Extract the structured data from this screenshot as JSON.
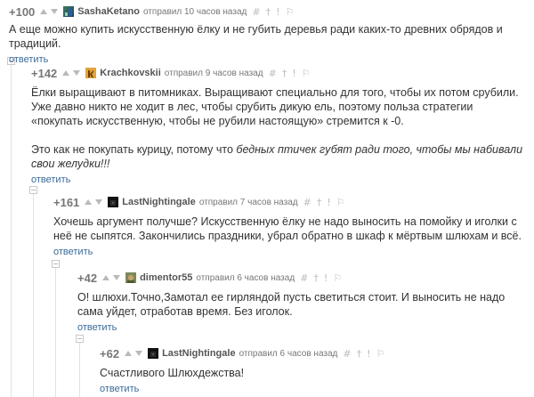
{
  "thread": {
    "c1": {
      "rating": "+100",
      "author": "SashaKetano",
      "meta": "отправил 10 часов назад",
      "text": "А еще можно купить искусственную ёлку и не губить деревья ради каких-то древних обрядов и традиций.",
      "reply": "ответить"
    },
    "c2": {
      "rating": "+142",
      "author": "Krachkovskii",
      "meta": "отправил 9 часов назад",
      "para1": "Ёлки выращивают в питомниках. Выращивают специально для того, чтобы их потом срубили. Уже давно никто не ходит в лес, чтобы срубить дикую ель, поэтому польза стратегии «покупать искусственную, чтобы не рубили настоящую» стремится к -0.",
      "para2_plain": "Это как не покупать курицу, потому что ",
      "para2_italic": "бедных птичек губят ради того, чтобы мы набивали свои желудки!!!",
      "reply": "ответить"
    },
    "c3": {
      "rating": "+161",
      "author": "LastNightingale",
      "meta": "отправил 7 часов назад",
      "text": "Хочешь аргумент получше? Искусственную ёлку не надо выносить на помойку и иголки с неё не сыпятся. Закончились праздники, убрал обратно в шкаф к мёртвым шлюхам и всё.",
      "reply": "ответить"
    },
    "c4": {
      "rating": "+42",
      "author": "dimentor55",
      "meta": "отправил 6 часов назад",
      "text": "О! шлюхи.Точно,Замотал ее гирляндой пусть светиться стоит. И выносить не надо сама уйдет, отработав время. Без иголок.",
      "reply": "ответить"
    },
    "c5": {
      "rating": "+62",
      "author": "LastNightingale",
      "meta": "отправил 6 часов назад",
      "text": "Счастливого Шлюхдежства!",
      "reply": "ответить"
    }
  },
  "icons": {
    "vote_up": "arrow-up-icon",
    "vote_down": "arrow-down-icon",
    "tools": [
      "hash-icon",
      "pin-icon",
      "mark-icon",
      "link-icon"
    ],
    "guide": "minus-box-icon"
  },
  "colors": {
    "reply_link": "#3a6b9a",
    "text": "#333333",
    "meta": "#777777",
    "tool": "#bdbdbd"
  }
}
